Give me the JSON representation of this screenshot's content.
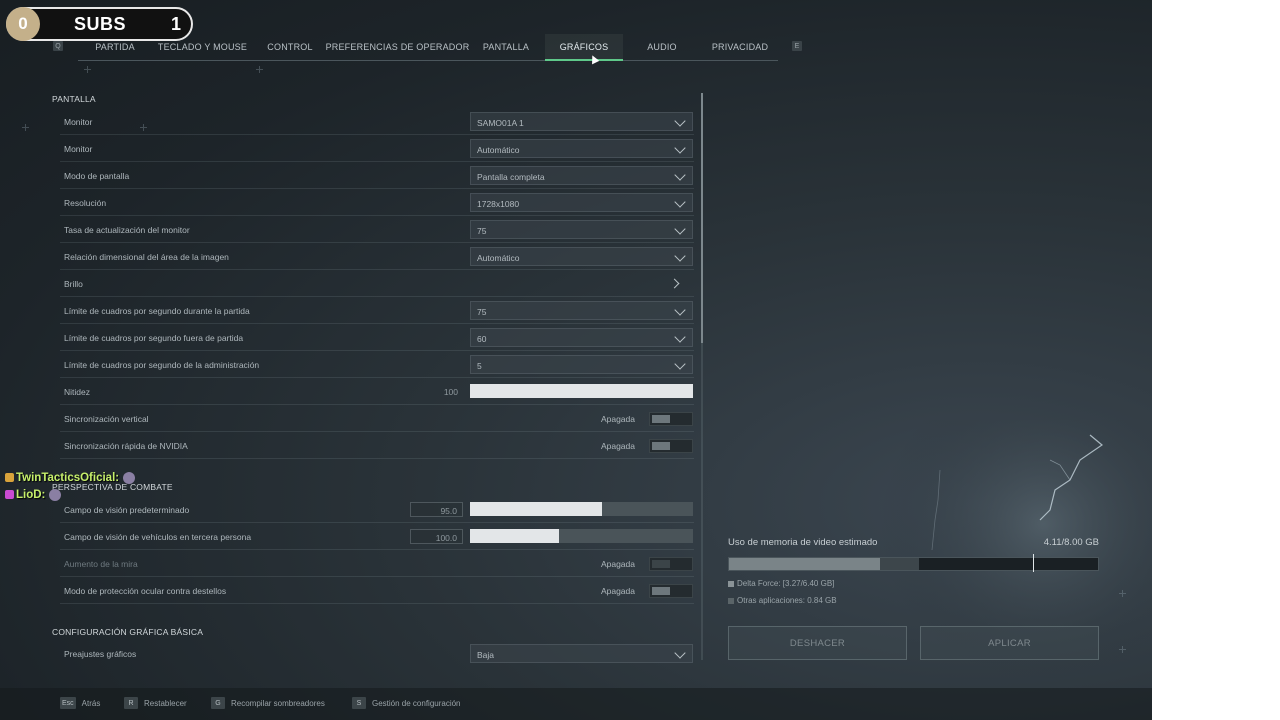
{
  "overlay": {
    "subs_left": "0",
    "subs_label": "SUBS",
    "subs_right": "1",
    "top_micro": "..."
  },
  "tabs": [
    {
      "key": "Q"
    },
    {
      "label": "PARTIDA"
    },
    {
      "label": "TECLADO Y MOUSE"
    },
    {
      "label": "CONTROL"
    },
    {
      "label": "PREFERENCIAS DE OPERADOR"
    },
    {
      "label": "PANTALLA"
    },
    {
      "label": "GRÁFICOS",
      "active": true
    },
    {
      "label": "AUDIO"
    },
    {
      "label": "PRIVACIDAD"
    },
    {
      "key": "E"
    }
  ],
  "sections": {
    "pantalla": {
      "title": "PANTALLA",
      "rows": [
        {
          "label": "Monitor",
          "value": "SAMO01A 1"
        },
        {
          "label": "Monitor",
          "value": "Automático"
        },
        {
          "label": "Modo de pantalla",
          "value": "Pantalla completa"
        },
        {
          "label": "Resolución",
          "value": "1728x1080"
        },
        {
          "label": "Tasa de actualización del monitor",
          "value": "75"
        },
        {
          "label": "Relación dimensional del área de la imagen",
          "value": "Automático"
        },
        {
          "label": "Brillo"
        },
        {
          "label": "Límite de cuadros por segundo durante la partida",
          "value": "75"
        },
        {
          "label": "Límite de cuadros por segundo fuera de partida",
          "value": "60"
        },
        {
          "label": "Límite de cuadros por segundo de la administración",
          "value": "5"
        },
        {
          "label": "Nitidez",
          "number": "100",
          "level": 1.0
        },
        {
          "label": "Sincronización vertical",
          "state": "Apagada"
        },
        {
          "label": "Sincronización rápida de NVIDIA",
          "state": "Apagada"
        }
      ]
    },
    "perspectiva": {
      "title": "PERSPECTIVA DE COMBATE",
      "rows": [
        {
          "label": "Campo de visión predeterminado",
          "number": "95.0",
          "level": 0.59
        },
        {
          "label": "Campo de visión de vehículos en tercera persona",
          "number": "100.0",
          "level": 0.4
        },
        {
          "label": "Aumento de la mira",
          "state": "Apagada"
        },
        {
          "label": "Modo de protección ocular contra destellos",
          "state": "Apagada"
        }
      ]
    },
    "basica": {
      "title": "CONFIGURACIÓN GRÁFICA BÁSICA",
      "rows": [
        {
          "label": "Preajustes gráficos",
          "value": "Baja"
        }
      ]
    }
  },
  "chat": [
    {
      "user": "TwinTacticsOficial:",
      "badge_color": "#d9a33b"
    },
    {
      "user": "LioD:",
      "badge_color": "#c94bd1"
    }
  ],
  "vram": {
    "title": "Uso de memoria de video estimado",
    "total": "4.11/8.00 GB",
    "delta_fraction": 0.41,
    "other_fraction": 0.105,
    "marker_fraction": 0.825,
    "legend": [
      {
        "label": "Delta Force: [3.27/6.40 GB]",
        "color": "#8a9397"
      },
      {
        "label": "Otras aplicaciones: 0.84 GB",
        "color": "#5a6468"
      }
    ],
    "undo_label": "DESHACER",
    "apply_label": "APLICAR"
  },
  "bottom_hints": [
    {
      "key": "Esc",
      "label": "Atrás"
    },
    {
      "key": "R",
      "label": "Restablecer"
    },
    {
      "key": "G",
      "label": "Recompilar sombreadores"
    },
    {
      "key": "S",
      "label": "Gestión de configuración"
    }
  ]
}
